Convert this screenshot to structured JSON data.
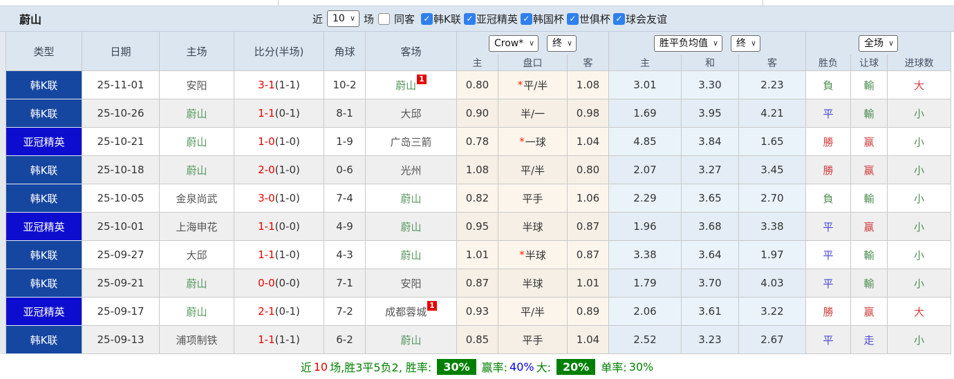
{
  "colors": {
    "header_bg": "#dce6f1",
    "kleague_badge": "#1546A0",
    "acl_badge": "#0D0DD0",
    "ulsan_green": "#55975c",
    "score_red": "#e60000",
    "win_red": "#d24040",
    "draw_blue": "#4646d8",
    "loss_green": "#4e8e52",
    "handicap_col_bg": "#fbf5ec",
    "odds1x2_col_bg": "#eaf3fa",
    "summary_badge_green": "#008000"
  },
  "toolbar": {
    "team_title": "蔚山",
    "recent_prefix": "近",
    "recent_count": "10",
    "recent_suffix": "场",
    "same_opponent": {
      "label": "同客",
      "checked": false
    },
    "league_filters": [
      {
        "label": "韩K联",
        "checked": true
      },
      {
        "label": "亚冠精英",
        "checked": true
      },
      {
        "label": "韩国杯",
        "checked": true
      },
      {
        "label": "世俱杯",
        "checked": true
      },
      {
        "label": "球会友谊",
        "checked": true
      }
    ]
  },
  "header": {
    "columns": [
      "类型",
      "日期",
      "主场",
      "比分(半场)",
      "角球",
      "客场"
    ],
    "handicap_group": {
      "bookmaker": "Crow*",
      "time": "终",
      "subs": [
        "主",
        "盘口",
        "客"
      ]
    },
    "odds_group": {
      "bookmaker": "胜平负均值",
      "time": "终",
      "subs": [
        "主",
        "和",
        "客"
      ]
    },
    "result_group": {
      "scope": "全场",
      "subs": [
        "胜负",
        "让球",
        "进球数"
      ]
    }
  },
  "table": {
    "rows": [
      {
        "league": "韩K联",
        "league_color": "#1546A0",
        "date": "25-11-01",
        "home": "安阳",
        "home_green": false,
        "home_sup": "",
        "score_ft": "3-1",
        "score_ht": "(1-1)",
        "corners": "10-2",
        "away": "蔚山",
        "away_green": true,
        "away_sup": "1",
        "ah_home": "0.80",
        "ah_star": true,
        "ah_line": "平/半",
        "ah_away": "1.08",
        "odds_home": "3.01",
        "odds_draw": "3.30",
        "odds_away": "2.23",
        "result": "負",
        "result_color": "green",
        "ah_result": "輸",
        "ah_result_color": "green",
        "goals": "大",
        "goals_color": "red"
      },
      {
        "league": "韩K联",
        "league_color": "#1546A0",
        "date": "25-10-26",
        "home": "蔚山",
        "home_green": true,
        "home_sup": "",
        "score_ft": "1-1",
        "score_ht": "(0-1)",
        "corners": "8-1",
        "away": "大邱",
        "away_green": false,
        "away_sup": "",
        "ah_home": "0.90",
        "ah_star": false,
        "ah_line": "半/一",
        "ah_away": "0.98",
        "odds_home": "1.69",
        "odds_draw": "3.95",
        "odds_away": "4.21",
        "result": "平",
        "result_color": "blue",
        "ah_result": "輸",
        "ah_result_color": "green",
        "goals": "小",
        "goals_color": "green"
      },
      {
        "league": "亚冠精英",
        "league_color": "#0D0DD0",
        "date": "25-10-21",
        "home": "蔚山",
        "home_green": true,
        "home_sup": "",
        "score_ft": "1-0",
        "score_ht": "(1-0)",
        "corners": "1-9",
        "away": "广岛三箭",
        "away_green": false,
        "away_sup": "",
        "ah_home": "0.78",
        "ah_star": true,
        "ah_line": "一球",
        "ah_away": "1.04",
        "odds_home": "4.85",
        "odds_draw": "3.84",
        "odds_away": "1.65",
        "result": "勝",
        "result_color": "red",
        "ah_result": "赢",
        "ah_result_color": "red",
        "goals": "小",
        "goals_color": "green"
      },
      {
        "league": "韩K联",
        "league_color": "#1546A0",
        "date": "25-10-18",
        "home": "蔚山",
        "home_green": true,
        "home_sup": "",
        "score_ft": "2-0",
        "score_ht": "(1-0)",
        "corners": "0-6",
        "away": "光州",
        "away_green": false,
        "away_sup": "",
        "ah_home": "1.08",
        "ah_star": false,
        "ah_line": "平/半",
        "ah_away": "0.80",
        "odds_home": "2.07",
        "odds_draw": "3.27",
        "odds_away": "3.45",
        "result": "勝",
        "result_color": "red",
        "ah_result": "赢",
        "ah_result_color": "red",
        "goals": "小",
        "goals_color": "green"
      },
      {
        "league": "韩K联",
        "league_color": "#1546A0",
        "date": "25-10-05",
        "home": "金泉尚武",
        "home_green": false,
        "home_sup": "",
        "score_ft": "3-0",
        "score_ht": "(1-0)",
        "corners": "7-4",
        "away": "蔚山",
        "away_green": true,
        "away_sup": "",
        "ah_home": "0.82",
        "ah_star": false,
        "ah_line": "平手",
        "ah_away": "1.06",
        "odds_home": "2.29",
        "odds_draw": "3.65",
        "odds_away": "2.70",
        "result": "負",
        "result_color": "green",
        "ah_result": "輸",
        "ah_result_color": "green",
        "goals": "小",
        "goals_color": "green"
      },
      {
        "league": "亚冠精英",
        "league_color": "#0D0DD0",
        "date": "25-10-01",
        "home": "上海申花",
        "home_green": false,
        "home_sup": "",
        "score_ft": "1-1",
        "score_ht": "(0-0)",
        "corners": "4-9",
        "away": "蔚山",
        "away_green": true,
        "away_sup": "",
        "ah_home": "0.95",
        "ah_star": false,
        "ah_line": "半球",
        "ah_away": "0.87",
        "odds_home": "1.96",
        "odds_draw": "3.68",
        "odds_away": "3.38",
        "result": "平",
        "result_color": "blue",
        "ah_result": "赢",
        "ah_result_color": "red",
        "goals": "小",
        "goals_color": "green"
      },
      {
        "league": "韩K联",
        "league_color": "#1546A0",
        "date": "25-09-27",
        "home": "大邱",
        "home_green": false,
        "home_sup": "",
        "score_ft": "1-1",
        "score_ht": "(1-0)",
        "corners": "4-3",
        "away": "蔚山",
        "away_green": true,
        "away_sup": "",
        "ah_home": "1.01",
        "ah_star": true,
        "ah_line": "半球",
        "ah_away": "0.87",
        "odds_home": "3.38",
        "odds_draw": "3.64",
        "odds_away": "1.97",
        "result": "平",
        "result_color": "blue",
        "ah_result": "輸",
        "ah_result_color": "green",
        "goals": "小",
        "goals_color": "green"
      },
      {
        "league": "韩K联",
        "league_color": "#1546A0",
        "date": "25-09-21",
        "home": "蔚山",
        "home_green": true,
        "home_sup": "",
        "score_ft": "0-0",
        "score_ht": "(0-0)",
        "corners": "7-1",
        "away": "安阳",
        "away_green": false,
        "away_sup": "",
        "ah_home": "0.87",
        "ah_star": false,
        "ah_line": "半球",
        "ah_away": "1.01",
        "odds_home": "1.79",
        "odds_draw": "3.70",
        "odds_away": "4.03",
        "result": "平",
        "result_color": "blue",
        "ah_result": "輸",
        "ah_result_color": "green",
        "goals": "小",
        "goals_color": "green"
      },
      {
        "league": "亚冠精英",
        "league_color": "#0D0DD0",
        "date": "25-09-17",
        "home": "蔚山",
        "home_green": true,
        "home_sup": "",
        "score_ft": "2-1",
        "score_ht": "(0-1)",
        "corners": "7-2",
        "away": "成都蓉城",
        "away_green": false,
        "away_sup": "1",
        "ah_home": "0.93",
        "ah_star": false,
        "ah_line": "平/半",
        "ah_away": "0.89",
        "odds_home": "2.06",
        "odds_draw": "3.61",
        "odds_away": "3.22",
        "result": "勝",
        "result_color": "red",
        "ah_result": "赢",
        "ah_result_color": "red",
        "goals": "大",
        "goals_color": "red"
      },
      {
        "league": "韩K联",
        "league_color": "#1546A0",
        "date": "25-09-13",
        "home": "浦项制铁",
        "home_green": false,
        "home_sup": "",
        "score_ft": "1-1",
        "score_ht": "(1-1)",
        "corners": "6-2",
        "away": "蔚山",
        "away_green": true,
        "away_sup": "",
        "ah_home": "0.85",
        "ah_star": false,
        "ah_line": "平手",
        "ah_away": "1.04",
        "odds_home": "2.52",
        "odds_draw": "3.23",
        "odds_away": "2.67",
        "result": "平",
        "result_color": "blue",
        "ah_result": "走",
        "ah_result_color": "blue",
        "goals": "小",
        "goals_color": "green"
      }
    ]
  },
  "summary": {
    "segments": [
      {
        "text": "近",
        "color": "green"
      },
      {
        "text": "10",
        "color": "red"
      },
      {
        "text": "场,胜3平5负2, 胜率:",
        "color": "green"
      },
      {
        "text": "30%",
        "badge": true
      },
      {
        "text": "赢率:",
        "color": "green"
      },
      {
        "text": "40%",
        "color": "blue"
      },
      {
        "text": "大:",
        "color": "green"
      },
      {
        "text": "20%",
        "badge": true
      },
      {
        "text": "单率:",
        "color": "green"
      },
      {
        "text": "30%",
        "color": "green"
      }
    ]
  }
}
